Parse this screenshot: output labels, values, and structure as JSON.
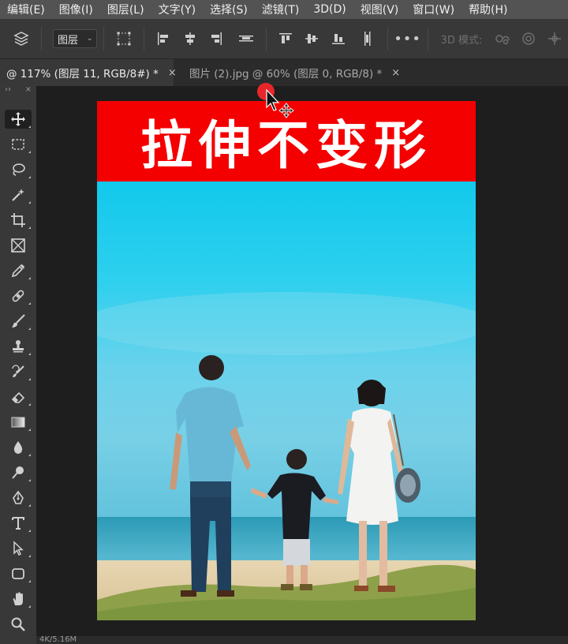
{
  "menu": [
    "编辑(E)",
    "图像(I)",
    "图层(L)",
    "文字(Y)",
    "选择(S)",
    "滤镜(T)",
    "3D(D)",
    "视图(V)",
    "窗口(W)",
    "帮助(H)"
  ],
  "options_bar": {
    "auto_select_value": "图层",
    "mode_3d_label": "3D 模式:"
  },
  "tabs": [
    {
      "label": "@ 117% (图层 11, RGB/8#) *",
      "close": "×"
    },
    {
      "label": "图片 (2).jpg @ 60% (图层 0, RGB/8) *",
      "close": "×"
    }
  ],
  "panel_header": {
    "collapse": "››",
    "close": "×"
  },
  "tools": [
    "move-tool",
    "marquee-tool",
    "lasso-tool",
    "magic-wand-tool",
    "crop-tool",
    "frame-tool",
    "eyedropper-tool",
    "healing-brush-tool",
    "brush-tool",
    "clone-stamp-tool",
    "history-brush-tool",
    "eraser-tool",
    "gradient-tool",
    "blur-tool",
    "dodge-tool",
    "pen-tool",
    "type-tool",
    "path-selection-tool",
    "shape-tool",
    "hand-tool",
    "zoom-tool"
  ],
  "document": {
    "banner_text": "拉伸不变形",
    "banner_color": "#f40000"
  },
  "status": "4K/5.16M"
}
